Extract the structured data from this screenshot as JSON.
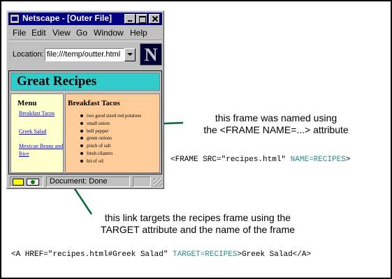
{
  "window": {
    "title": "Netscape - [Outer File]",
    "menu": [
      "File",
      "Edit",
      "View",
      "Go",
      "Window",
      "Help"
    ],
    "location_label": "Location:",
    "location_value": "file:///temp/outter.html",
    "logo_letter": "N",
    "status_text": "Document: Done"
  },
  "page": {
    "banner_title": "Great Recipes",
    "menu_title": "Menu",
    "menu_links": [
      "Breakfast Tacos",
      "Greek Salad",
      "Mexican Beans and Rice"
    ],
    "recipe_title": "Breakfast Tacos",
    "ingredients": [
      "two good sized red potatoes",
      "small onion",
      "bell pepper",
      "green onions",
      "pinch of salt",
      "fresh cilantro",
      "bit of oil"
    ]
  },
  "callouts": {
    "frame_note_line1": "this frame was named using",
    "frame_note_line2": "the <FRAME NAME=...> attribute",
    "frame_code_pre": "<FRAME SRC=\"recipes.html\" ",
    "frame_code_attr": "NAME=RECIPES",
    "frame_code_post": ">",
    "link_note_line1": "this link targets the recipes frame using the",
    "link_note_line2": "TARGET attribute and the name of the frame",
    "anchor_code_pre": "<A HREF=\"recipes.html#Greek Salad\" ",
    "anchor_code_attr": "TARGET=RECIPES",
    "anchor_code_post": ">Greek Salad</A>"
  },
  "colors": {
    "title_bar": "#000080",
    "banner": "#33cccc",
    "menu_frame": "#ffffcc",
    "recipes_frame": "#ffcc99",
    "callout_line": "#006633",
    "code_attr": "#2e8b8b"
  }
}
